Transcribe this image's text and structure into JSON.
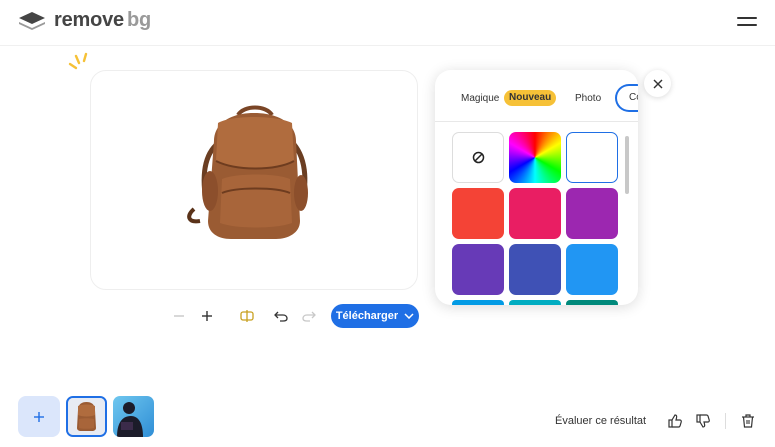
{
  "header": {
    "logo_remove": "remove",
    "logo_bg": "bg"
  },
  "toolbar": {
    "download_label": "Télécharger"
  },
  "panel": {
    "tabs": [
      {
        "label": "Magique"
      },
      {
        "label": "Nouveau"
      },
      {
        "label": "Photo"
      },
      {
        "label": "Co"
      }
    ],
    "swatches": [
      {
        "name": "none"
      },
      {
        "name": "rainbow-gradient"
      },
      {
        "name": "white",
        "color": "#ffffff"
      },
      {
        "name": "red",
        "color": "#f44336"
      },
      {
        "name": "pink",
        "color": "#e91e63"
      },
      {
        "name": "purple",
        "color": "#9c27b0"
      },
      {
        "name": "deep-purple",
        "color": "#673ab7"
      },
      {
        "name": "indigo",
        "color": "#3f51b5"
      },
      {
        "name": "blue",
        "color": "#2196f3"
      },
      {
        "name": "light-blue",
        "color": "#039be5"
      },
      {
        "name": "cyan",
        "color": "#00acc1"
      },
      {
        "name": "teal",
        "color": "#00897b"
      }
    ]
  },
  "footer": {
    "rate_label": "Évaluer ce résultat"
  },
  "colors": {
    "accent": "#1f6fe5",
    "badge": "#f6c137"
  }
}
